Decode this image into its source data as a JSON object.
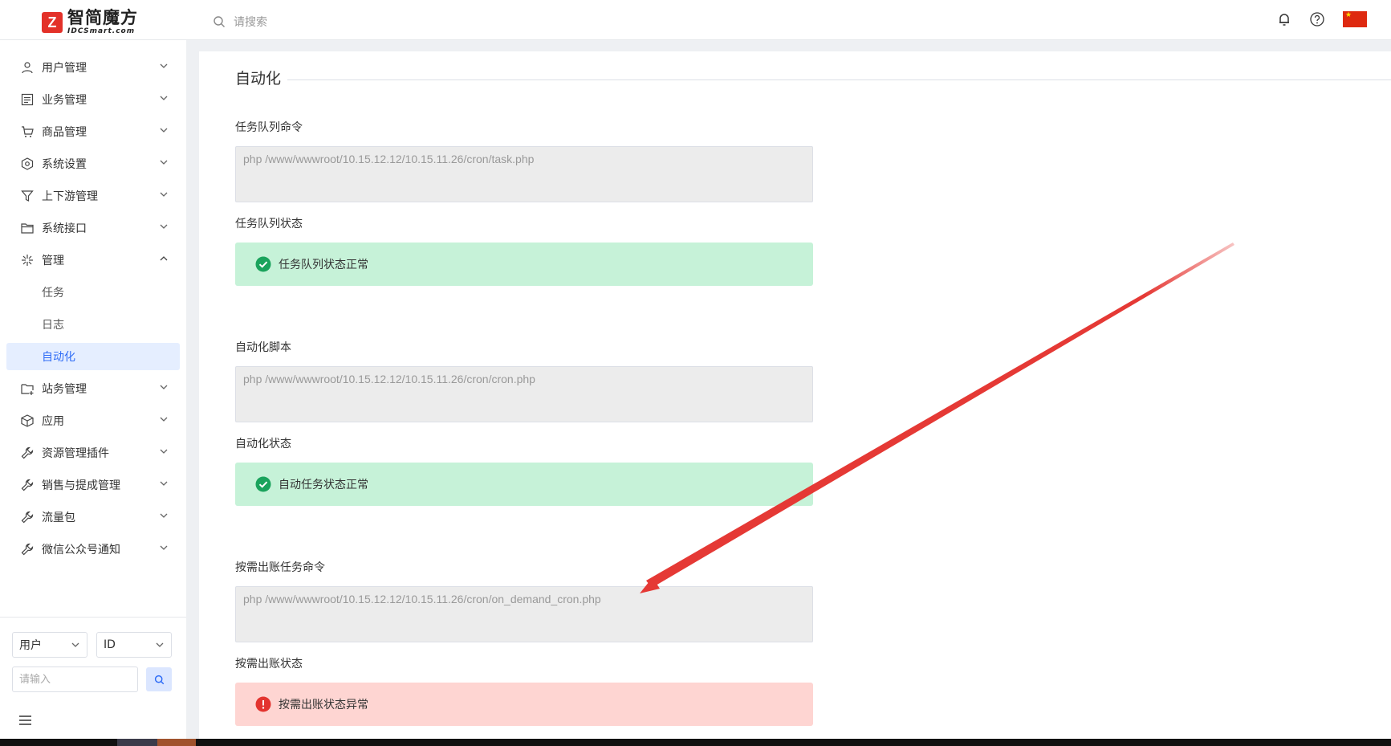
{
  "header": {
    "logo_cn": "智简魔方",
    "logo_en": "IDCSmart.com",
    "search_placeholder": "请搜索",
    "icons": [
      "bell-icon",
      "help-icon",
      "china-flag-icon"
    ]
  },
  "sidebar": {
    "items": [
      {
        "label": "用户管理",
        "icon": "user-icon",
        "expanded": false
      },
      {
        "label": "业务管理",
        "icon": "list-icon",
        "expanded": false
      },
      {
        "label": "商品管理",
        "icon": "cart-icon",
        "expanded": false
      },
      {
        "label": "系统设置",
        "icon": "settings-icon",
        "expanded": false
      },
      {
        "label": "上下游管理",
        "icon": "filter-icon",
        "expanded": false
      },
      {
        "label": "系统接口",
        "icon": "folder-icon",
        "expanded": false
      },
      {
        "label": "管理",
        "icon": "asterisk-icon",
        "expanded": true
      },
      {
        "label": "任务",
        "sub": true
      },
      {
        "label": "日志",
        "sub": true
      },
      {
        "label": "自动化",
        "sub": true,
        "active": true
      },
      {
        "label": "站务管理",
        "icon": "folder-add-icon",
        "expanded": false
      },
      {
        "label": "应用",
        "icon": "cube-icon",
        "expanded": false
      },
      {
        "label": "资源管理插件",
        "icon": "wrench-icon",
        "expanded": false
      },
      {
        "label": "销售与提成管理",
        "icon": "wrench-icon",
        "expanded": false
      },
      {
        "label": "流量包",
        "icon": "wrench-icon",
        "expanded": false
      },
      {
        "label": "微信公众号通知",
        "icon": "wrench-icon",
        "expanded": false
      }
    ],
    "search": {
      "type_select": "用户",
      "field_select": "ID",
      "input_placeholder": "请输入"
    }
  },
  "main": {
    "title": "自动化",
    "sections": [
      {
        "label": "任务队列命令",
        "command": "php /www/wwwroot/10.15.12.12/10.15.11.26/cron/task.php",
        "status_label": "任务队列状态",
        "status_text": "任务队列状态正常",
        "status": "ok"
      },
      {
        "label": "自动化脚本",
        "command": "php /www/wwwroot/10.15.12.12/10.15.11.26/cron/cron.php",
        "status_label": "自动化状态",
        "status_text": "自动任务状态正常",
        "status": "ok"
      },
      {
        "label": "按需出账任务命令",
        "command": "php /www/wwwroot/10.15.12.12/10.15.11.26/cron/on_demand_cron.php",
        "status_label": "按需出账状态",
        "status_text": "按需出账状态异常",
        "status": "error"
      }
    ]
  },
  "colors": {
    "accent": "#2f6cf6",
    "ok_bg": "#c6f2d8",
    "ok_icon": "#1aa35c",
    "error_bg": "#fed5d2",
    "error_icon": "#e3342f",
    "annotation_arrow": "#e53935"
  }
}
